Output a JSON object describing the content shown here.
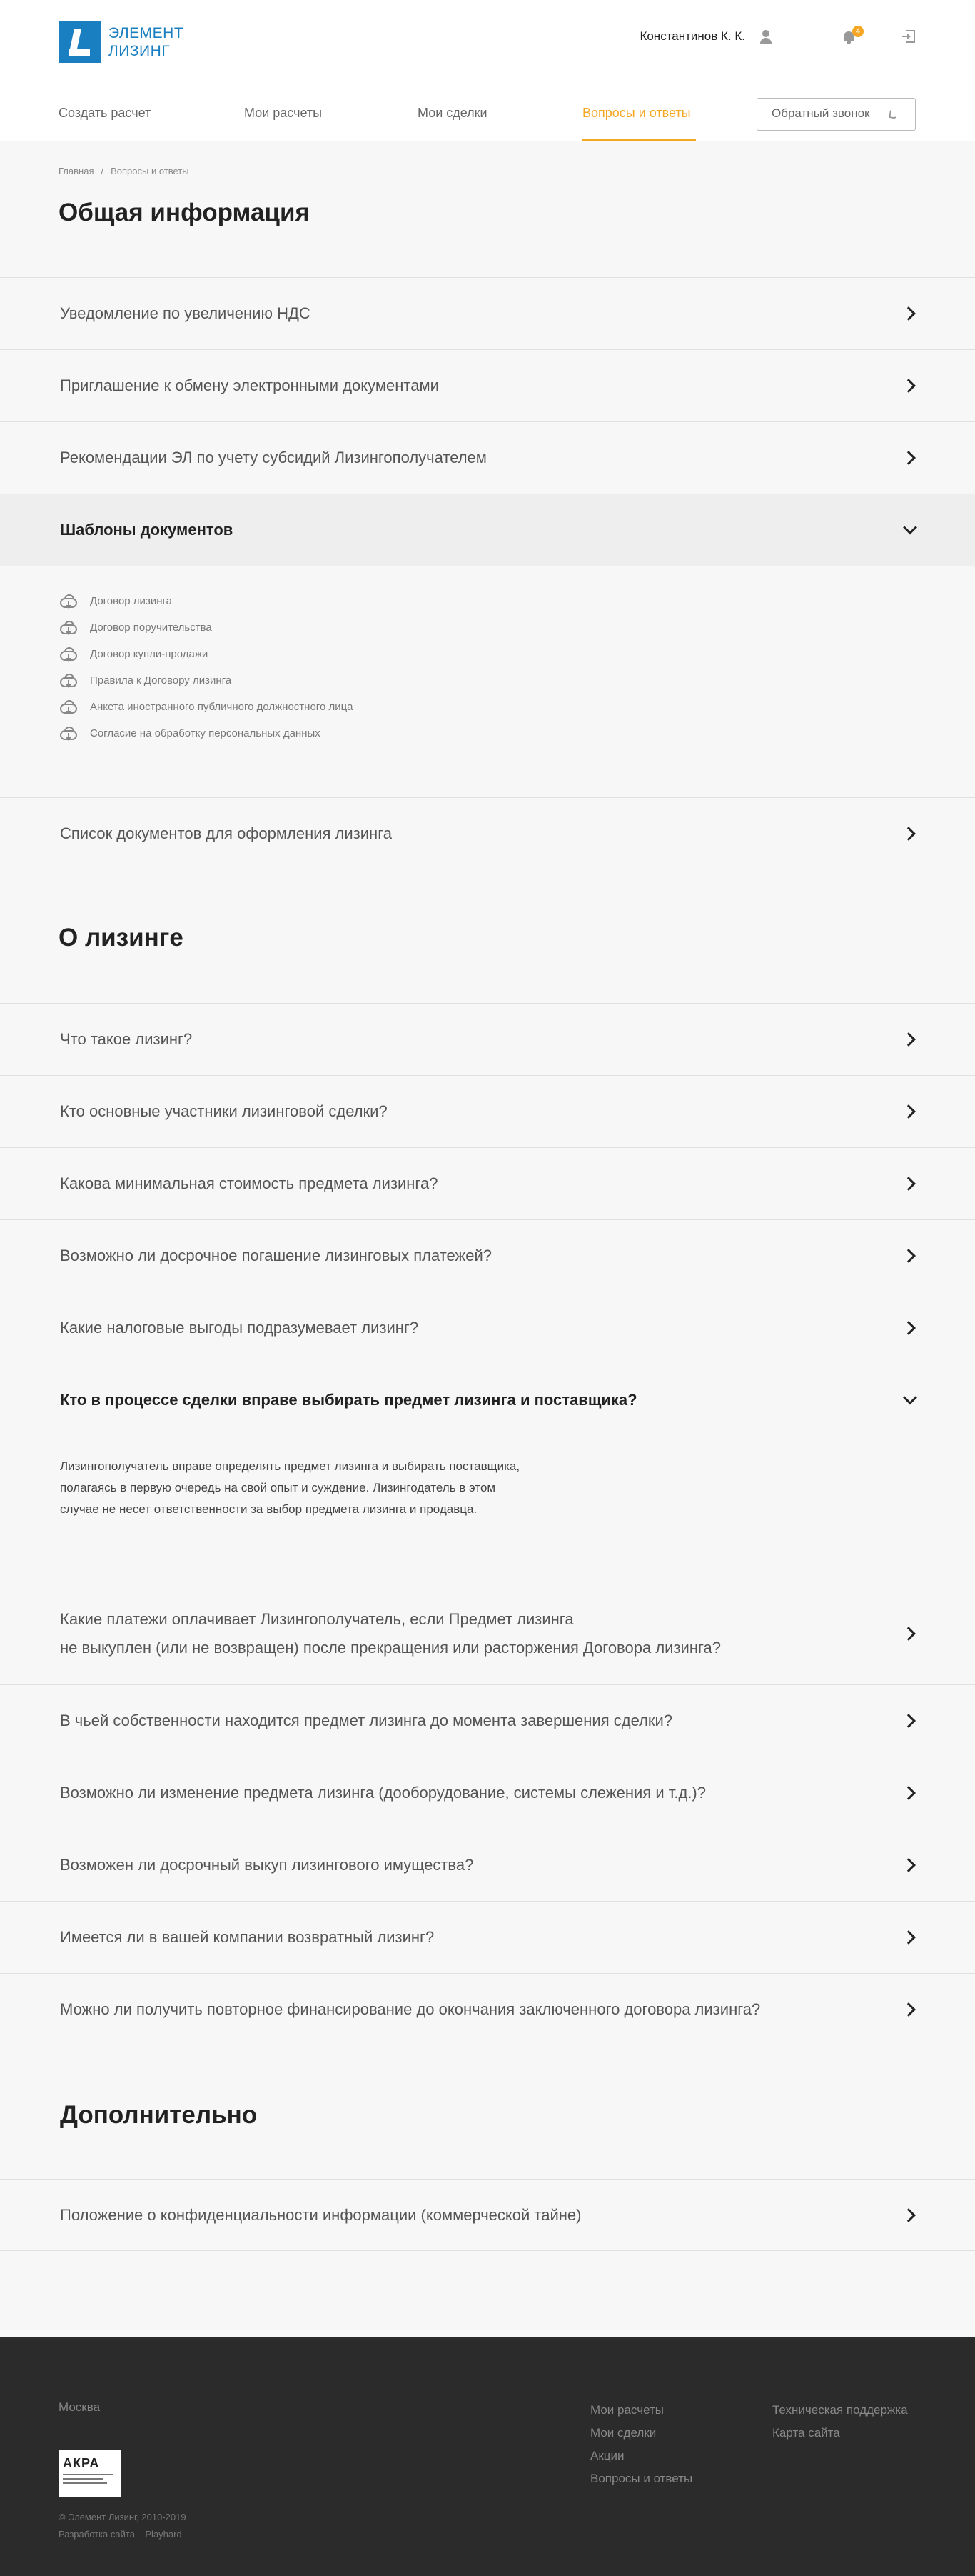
{
  "header": {
    "logo_line1": "ЭЛЕМЕНТ",
    "logo_line2": "ЛИЗИНГ",
    "user_name": "Константинов К. К.",
    "notification_count": "4",
    "nav": [
      "Создать расчет",
      "Мои расчеты",
      "Мои сделки",
      "Вопросы и ответы"
    ],
    "callback_label": "Обратный звонок"
  },
  "breadcrumb": [
    "Главная",
    "Вопросы и ответы"
  ],
  "general": {
    "title": "Общая информация",
    "items": [
      "Уведомление по увеличению НДС",
      "Приглашение к обмену электронными документами",
      "Рекомендации ЭЛ по учету субсидий Лизингополучателем"
    ],
    "open_item": "Шаблоны документов",
    "documents": [
      "Договор лизинга",
      "Договор поручительства",
      "Договор купли-продажи",
      "Правила к Договору лизинга",
      "Анкета иностранного публичного должностного лица",
      "Согласие на обработку персональных данных"
    ],
    "after_item": "Список документов для оформления лизинга"
  },
  "about": {
    "title": "О лизинге",
    "items_before": [
      "Что такое лизинг?",
      "Кто основные участники лизинговой сделки?",
      "Какова минимальная стоимость предмета лизинга?",
      "Возможно ли досрочное погашение лизинговых платежей?",
      "Какие налоговые выгоды подразумевает лизинг?"
    ],
    "open_question": "Кто в процессе сделки вправе выбирать предмет лизинга и поставщика?",
    "answer_lines": [
      "Лизингополучатель вправе определять предмет лизинга и выбирать поставщика,",
      "полагаясь в первую очередь на свой опыт и суждение. Лизингодатель в этом",
      "случае не несет ответственности за выбор предмета лизинга и продавца."
    ],
    "long_item_line1": "Какие платежи оплачивает Лизингополучатель, если Предмет лизинга",
    "long_item_line2": "не выкуплен (или не возвращен) после прекращения или расторжения Договора лизинга?",
    "items_after": [
      "В чьей собственности находится предмет лизинга до момента завершения сделки?",
      "Возможно ли изменение предмета лизинга (дооборудование, системы слежения и т.д.)?",
      "Возможен ли досрочный выкуп лизингового имущества?",
      "Имеется ли в вашей компании возвратный лизинг?",
      "Можно ли получить повторное финансирование до окончания заключенного договора лизинга?"
    ]
  },
  "extra": {
    "title": "Дополнительно",
    "items": [
      "Положение о конфиденциальности информации (коммерческой тайне)"
    ]
  },
  "footer": {
    "city": "Москва",
    "akra_label": "АКРА",
    "copyright": "© Элемент Лизинг, 2010-2019",
    "developer": "Разработка сайта – Playhard",
    "col1": [
      "Мои расчеты",
      "Мои сделки",
      "Акции",
      "Вопросы и ответы"
    ],
    "col2": [
      "Техническая поддержка",
      "Карта сайта"
    ]
  },
  "colors": {
    "brand": "#1a7fc1",
    "accent": "#f5a623",
    "footer_bg": "#2b2b2b"
  }
}
